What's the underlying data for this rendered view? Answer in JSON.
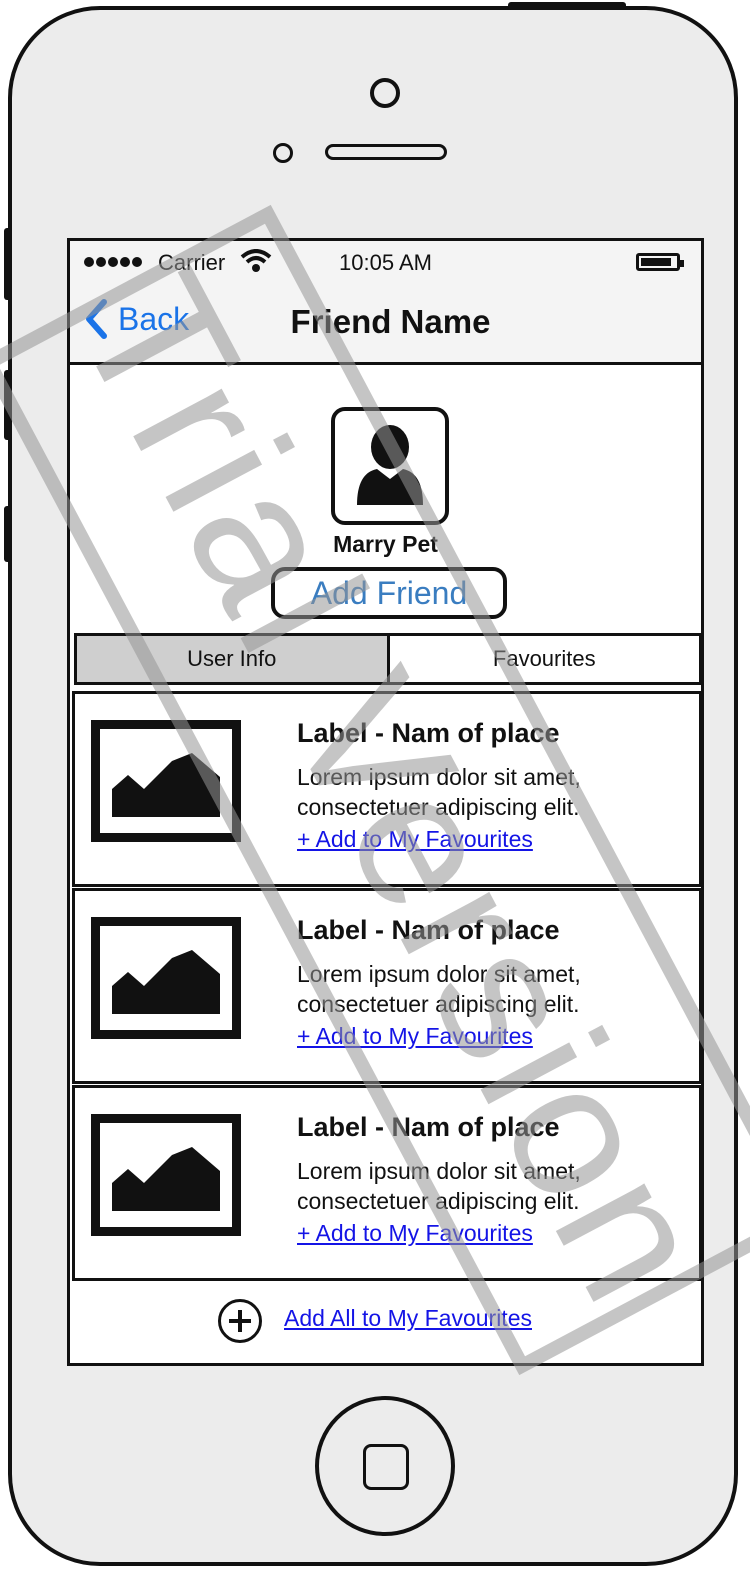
{
  "status_bar": {
    "carrier": "Carrier",
    "time": "10:05 AM",
    "icons": [
      "signal-dots-icon",
      "wifi-icon",
      "battery-icon"
    ]
  },
  "nav_bar": {
    "back_label": "Back",
    "title": "Friend Name"
  },
  "profile": {
    "name": "Marry Pet",
    "add_friend_label": "Add Friend",
    "avatar_icon": "user-avatar-icon"
  },
  "tabs": [
    {
      "label": "User Info",
      "active": true
    },
    {
      "label": "Favourites",
      "active": false
    }
  ],
  "places": [
    {
      "title": "Label - Nam of place",
      "description": "Lorem ipsum dolor sit amet, consectetuer adipiscing elit.",
      "link": "+ Add to My Favourites"
    },
    {
      "title": "Label - Nam of place",
      "description": "Lorem ipsum dolor sit amet, consectetuer adipiscing elit.",
      "link": "+ Add to My Favourites"
    },
    {
      "title": "Label - Nam of place",
      "description": "Lorem ipsum dolor sit amet, consectetuer adipiscing elit.",
      "link": "+ Add to My Favourites"
    }
  ],
  "footer": {
    "add_all_label": "Add All to My Favourites"
  },
  "watermark": "Trial Version",
  "colors": {
    "link": "#1414e6",
    "back": "#1a73e8",
    "add_friend_text": "#3a7dc0",
    "active_tab": "#cfcfcf",
    "device": "#ececec"
  }
}
